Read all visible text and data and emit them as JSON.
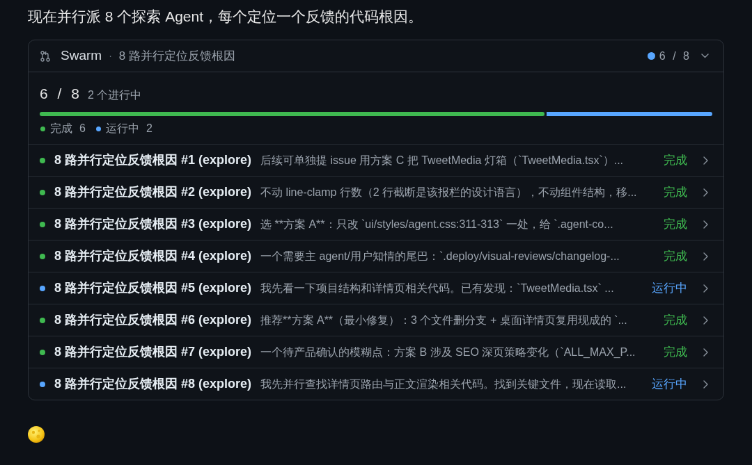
{
  "intro": "现在并行派 8 个探索 Agent，每个定位一个反馈的代码根因。",
  "swarm_card": {
    "header": {
      "title": "Swarm",
      "separator": "·",
      "subtitle": "8 路并行定位反馈根因",
      "indicator": {
        "color": "#58a6ff"
      },
      "counter": "6 / 8"
    },
    "summary": {
      "count": "6 / 8",
      "note": "2 个进行中"
    },
    "progress": {
      "segments": [
        {
          "level": 0.75,
          "color": "#3fb950"
        },
        {
          "level": 0.25,
          "color": "#58a6ff"
        }
      ]
    },
    "legend": [
      {
        "label": "完成",
        "count": "6",
        "color": "#3fb950"
      },
      {
        "label": "运行中",
        "count": "2",
        "color": "#58a6ff"
      }
    ],
    "rows": [
      {
        "title": "8 路并行定位反馈根因 #1 (explore)",
        "summary": "后续可单独提 issue 用方案 C 把 TweetMedia 灯箱（`TweetMedia.tsx`）...",
        "status": "完成",
        "color": "#3fb950"
      },
      {
        "title": "8 路并行定位反馈根因 #2 (explore)",
        "summary": "不动 line-clamp 行数（2 行截断是该报栏的设计语言），不动组件结构，移...",
        "status": "完成",
        "color": "#3fb950"
      },
      {
        "title": "8 路并行定位反馈根因 #3 (explore)",
        "summary": "选 **方案 A**：只改 `ui/styles/agent.css:311-313` 一处，给 `.agent-co...",
        "status": "完成",
        "color": "#3fb950"
      },
      {
        "title": "8 路并行定位反馈根因 #4 (explore)",
        "summary": "一个需要主 agent/用户知情的尾巴：`.deploy/visual-reviews/changelog-...",
        "status": "完成",
        "color": "#3fb950"
      },
      {
        "title": "8 路并行定位反馈根因 #5 (explore)",
        "summary": "我先看一下项目结构和详情页相关代码。已有发现：`TweetMedia.tsx` ...",
        "status": "运行中",
        "color": "#58a6ff"
      },
      {
        "title": "8 路并行定位反馈根因 #6 (explore)",
        "summary": "推荐**方案 A**（最小修复）：3 个文件删分支 + 桌面详情页复用现成的 `...",
        "status": "完成",
        "color": "#3fb950"
      },
      {
        "title": "8 路并行定位反馈根因 #7 (explore)",
        "summary": "一个待产品确认的模糊点：方案 B 涉及 SEO 深页策略变化（`ALL_MAX_P...",
        "status": "完成",
        "color": "#3fb950"
      },
      {
        "title": "8 路并行定位反馈根因 #8 (explore)",
        "summary": "我先并行查找详情页路由与正文渲染相关代码。找到关键文件，现在读取...",
        "status": "运行中",
        "color": "#58a6ff"
      }
    ]
  }
}
